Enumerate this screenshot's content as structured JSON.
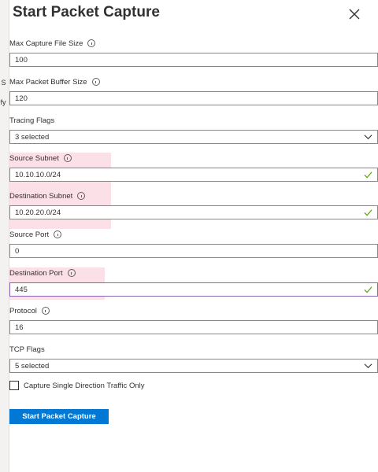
{
  "background": {
    "fragment1": "e S",
    "fragment2": "cify"
  },
  "header": {
    "title": "Start Packet Capture"
  },
  "fields": {
    "max_capture_file_size": {
      "label": "Max Capture File Size",
      "value": "100"
    },
    "max_packet_buffer_size": {
      "label": "Max Packet Buffer Size",
      "value": "120"
    },
    "tracing_flags": {
      "label": "Tracing Flags",
      "value": "3 selected"
    },
    "source_subnet": {
      "label": "Source Subnet",
      "value": "10.10.10.0/24"
    },
    "destination_subnet": {
      "label": "Destination Subnet",
      "value": "10.20.20.0/24"
    },
    "source_port": {
      "label": "Source Port",
      "value": "0"
    },
    "destination_port": {
      "label": "Destination Port",
      "value": "445"
    },
    "protocol": {
      "label": "Protocol",
      "value": "16"
    },
    "tcp_flags": {
      "label": "TCP Flags",
      "value": "5 selected"
    }
  },
  "checkbox": {
    "label": "Capture Single Direction Traffic Only",
    "checked": false
  },
  "button": {
    "label": "Start Packet Capture"
  },
  "colors": {
    "accent": "#0078d4",
    "highlight": "#fbd5e0",
    "valid": "#57a300",
    "focus": "#8764b8"
  },
  "icons": {
    "close": "close-icon",
    "info": "info-icon",
    "valid": "checkmark-icon",
    "dropdown": "chevron-down-icon"
  }
}
